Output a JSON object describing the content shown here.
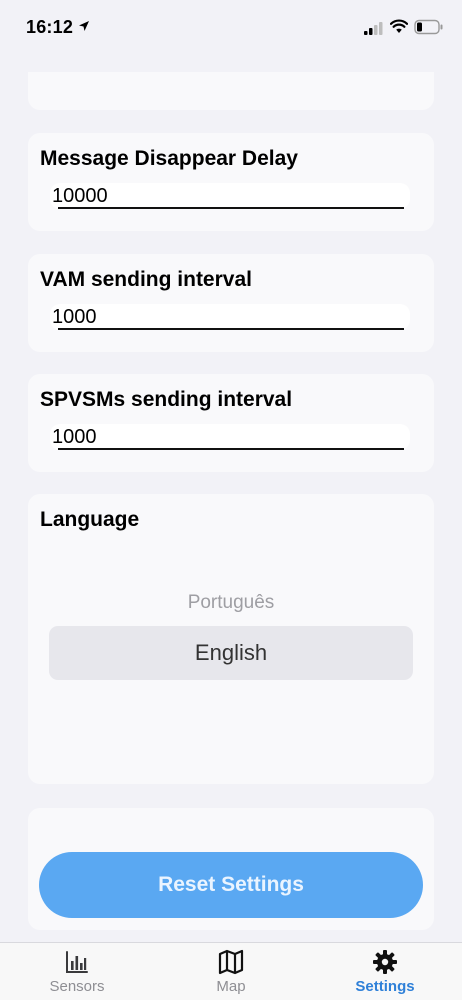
{
  "status_bar": {
    "time": "16:12"
  },
  "settings": {
    "message_delay": {
      "title": "Message Disappear Delay",
      "value": "10000"
    },
    "vam_interval": {
      "title": "VAM sending interval",
      "value": "1000"
    },
    "spvsm_interval": {
      "title": "SPVSMs sending interval",
      "value": "1000"
    },
    "language": {
      "title": "Language",
      "options": [
        "Português",
        "English"
      ],
      "selected": "English"
    },
    "reset_label": "Reset Settings"
  },
  "tab_bar": {
    "tabs": [
      {
        "label": "Sensors",
        "icon": "bar-chart-icon"
      },
      {
        "label": "Map",
        "icon": "map-icon"
      },
      {
        "label": "Settings",
        "icon": "gear-icon",
        "active": true
      }
    ]
  },
  "colors": {
    "accent": "#2f80d8",
    "button": "#5aa8f2",
    "background": "#f2f2f7",
    "card": "#f9f9fb"
  }
}
